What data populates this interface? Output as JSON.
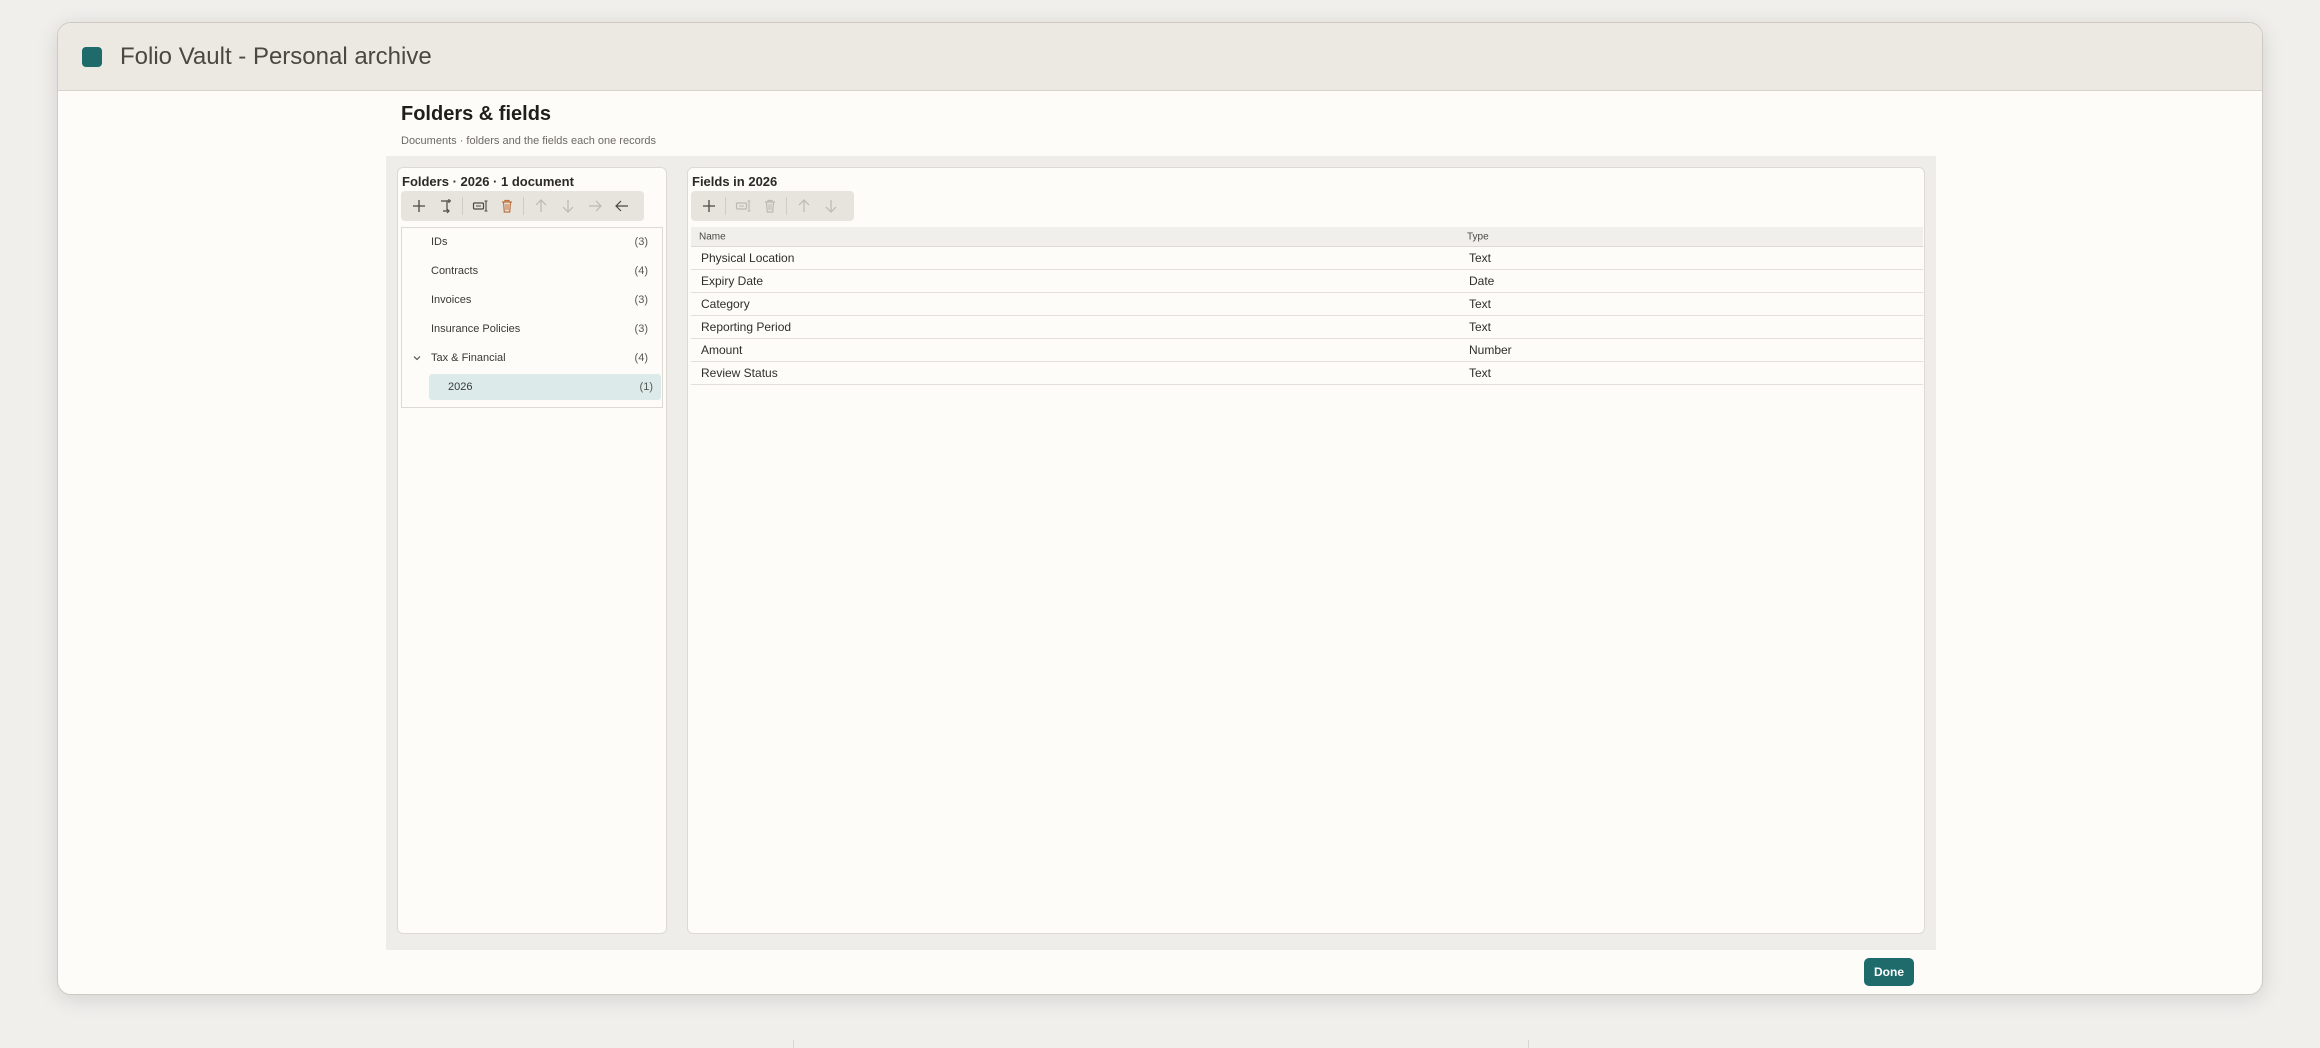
{
  "window": {
    "title": "Folio Vault - Personal archive"
  },
  "header": {
    "title": "Folders & fields",
    "subtitle": "Documents · folders and the fields each one records"
  },
  "folders_panel": {
    "title": "Folders · 2026 · 1 document",
    "toolbar": [
      {
        "icon": "plus-icon",
        "enabled": true
      },
      {
        "icon": "add-subfolder-icon",
        "enabled": true
      },
      {
        "icon": "rename-icon",
        "enabled": true
      },
      {
        "icon": "trash-icon",
        "enabled": true
      },
      {
        "icon": "arrow-up-icon",
        "enabled": false
      },
      {
        "icon": "arrow-down-icon",
        "enabled": false
      },
      {
        "icon": "arrow-right-icon",
        "enabled": false
      },
      {
        "icon": "arrow-left-icon",
        "enabled": true
      }
    ],
    "tree": [
      {
        "label": "IDs",
        "count": "(3)"
      },
      {
        "label": "Contracts",
        "count": "(4)"
      },
      {
        "label": "Invoices",
        "count": "(3)"
      },
      {
        "label": "Insurance Policies",
        "count": "(3)"
      },
      {
        "label": "Tax & Financial",
        "count": "(4)",
        "expanded": true
      },
      {
        "label": "2026",
        "count": "(1)",
        "selected": true
      }
    ]
  },
  "fields_panel": {
    "title": "Fields in 2026",
    "toolbar": [
      {
        "icon": "plus-icon",
        "enabled": true
      },
      {
        "icon": "rename-icon",
        "enabled": false
      },
      {
        "icon": "trash-icon",
        "enabled": false
      },
      {
        "icon": "arrow-up-icon",
        "enabled": false
      },
      {
        "icon": "arrow-down-icon",
        "enabled": false
      }
    ],
    "columns": {
      "name": "Name",
      "type": "Type"
    },
    "rows": [
      {
        "name": "Physical Location",
        "type": "Text"
      },
      {
        "name": "Expiry Date",
        "type": "Date"
      },
      {
        "name": "Category",
        "type": "Text"
      },
      {
        "name": "Reporting Period",
        "type": "Text"
      },
      {
        "name": "Amount",
        "type": "Number"
      },
      {
        "name": "Review Status",
        "type": "Text"
      }
    ]
  },
  "footer": {
    "done_label": "Done"
  },
  "colors": {
    "accent": "#1f6b6b",
    "selection": "#dcebea",
    "delete": "#c0703a"
  }
}
